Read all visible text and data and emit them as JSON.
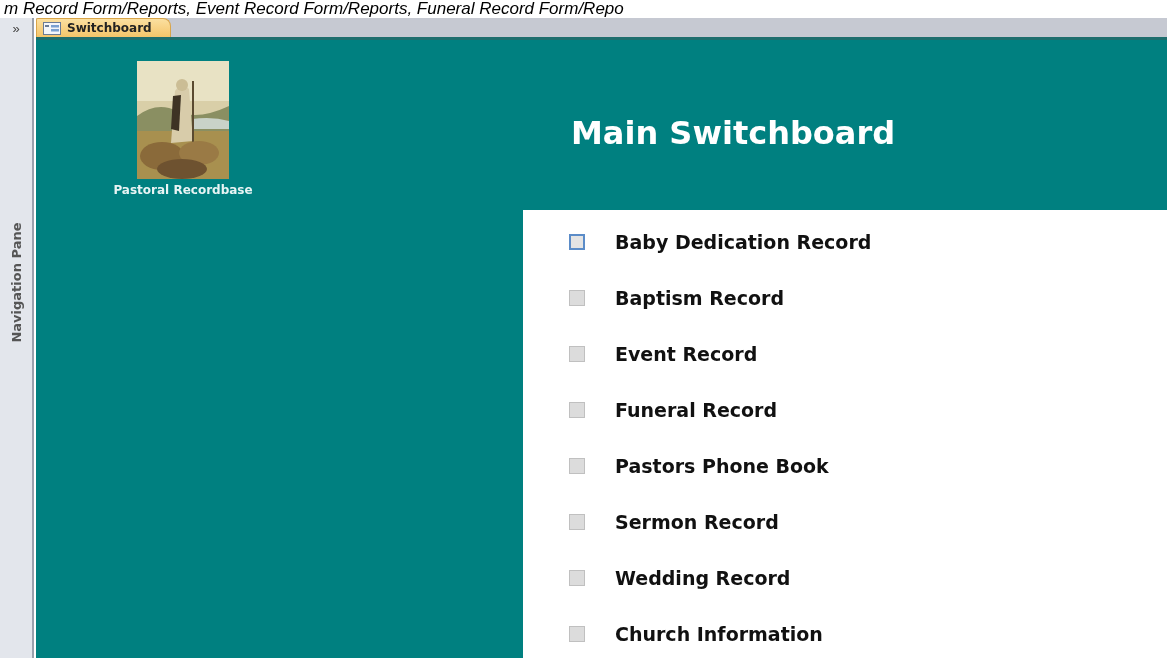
{
  "caption": "m Record Form/Reports, Event Record Form/Reports, Funeral Record Form/Repo",
  "navigation_pane": {
    "toggle": "»",
    "label": "Navigation Pane"
  },
  "tabs": [
    {
      "label": "Switchboard",
      "selected": true
    }
  ],
  "logo": {
    "kind": "picture",
    "caption": "Pastoral Recordbase"
  },
  "title": "Main Switchboard",
  "items": [
    {
      "label": "Baby Dedication Record",
      "selected": true
    },
    {
      "label": "Baptism Record",
      "selected": false
    },
    {
      "label": "Event Record",
      "selected": false
    },
    {
      "label": "Funeral Record",
      "selected": false
    },
    {
      "label": "Pastors Phone Book",
      "selected": false
    },
    {
      "label": "Sermon Record",
      "selected": false
    },
    {
      "label": "Wedding Record",
      "selected": false
    },
    {
      "label": "Church Information",
      "selected": false
    }
  ]
}
